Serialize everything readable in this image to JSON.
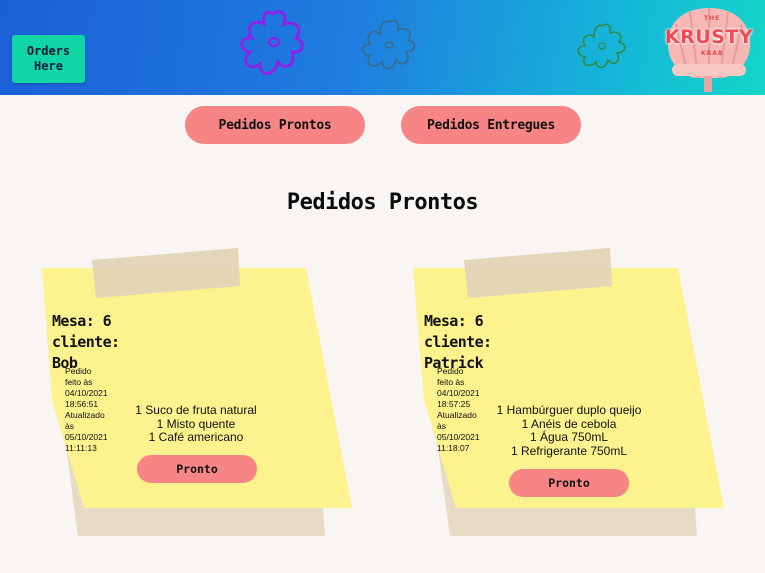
{
  "header": {
    "orders_button": "Orders\nHere",
    "logo": {
      "top_small": "THE",
      "main": "KRUSTY",
      "bottom_small": "KRAB"
    }
  },
  "tabs": [
    {
      "label": "Pedidos Prontos"
    },
    {
      "label": "Pedidos Entregues"
    }
  ],
  "page_title": "Pedidos Prontos",
  "orders": [
    {
      "mesa_line": "Mesa: 6",
      "cliente_line": "cliente: Bob",
      "pedido_feito": "Pedido feito às 04/10/2021 18:56:51",
      "atualizado": "Atualizado às 05/10/2021 11:11:13",
      "items": [
        "1 Suco de fruta natural",
        "1 Misto quente",
        "1 Café americano"
      ],
      "button_label": "Pronto"
    },
    {
      "mesa_line": "Mesa: 6",
      "cliente_line": "cliente: Patrick",
      "pedido_feito": "Pedido feito às 04/10/2021 18:57:25",
      "atualizado": "Atualizado às 05/10/2021 11:18:07",
      "items": [
        "1 Hambúrguer duplo queijo",
        "1 Anéis de cebola",
        "1 Água 750mL",
        "1 Refrigerante 750mL"
      ],
      "button_label": "Pronto"
    }
  ]
}
